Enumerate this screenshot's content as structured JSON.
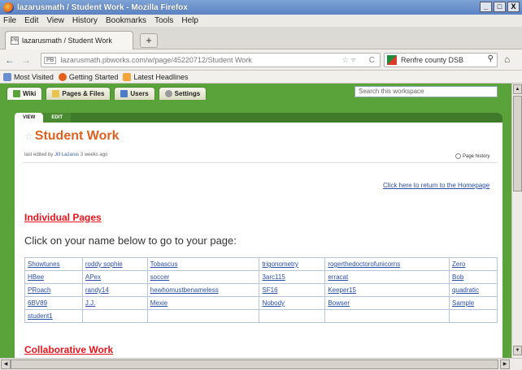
{
  "window": {
    "title": "lazarusmath / Student Work - Mozilla Firefox",
    "controls": [
      "_",
      "□",
      "X"
    ]
  },
  "menu": [
    "File",
    "Edit",
    "View",
    "History",
    "Bookmarks",
    "Tools",
    "Help"
  ],
  "tab": {
    "favicon": "PB",
    "label": "lazarusmath / Student Work",
    "new_tab": "+"
  },
  "nav": {
    "back": "←",
    "forward": "→",
    "url_badge": "PB",
    "url": "lazarusmath.pbworks.com/w/page/45220712/Student Work",
    "search_engine": "Renfre county DSB",
    "home": "⌂"
  },
  "bookmarks": [
    "Most Visited",
    "Getting Started",
    "Latest Headlines"
  ],
  "wiki": {
    "tabs": [
      {
        "label": "Wiki",
        "color": "#5aa33b"
      },
      {
        "label": "Pages & Files",
        "color": "#e8c24a"
      },
      {
        "label": "Users",
        "color": "#4a7cc8"
      },
      {
        "label": "Settings",
        "color": "#9a9a9a"
      }
    ],
    "search_placeholder": "Search this workspace",
    "view_label": "VIEW",
    "edit_label": "EDIT"
  },
  "page": {
    "title": "Student Work",
    "edited_prefix": "last edited by",
    "edited_user": "Jill Lazarus",
    "edited_when": "3 weeks ago",
    "history": "Page history",
    "home_link": "Click here to return to the Homepage",
    "section1": "Individual Pages",
    "intro": "Click on your name below to go to your page:",
    "names": [
      [
        "Showtunes",
        "roddy sophie",
        "Tobascus",
        "trigonometry",
        "rogerthedoctorofunicorns",
        "Zero"
      ],
      [
        "HBee",
        "APex",
        "soccer",
        "3arc115",
        "erracat",
        "Bob"
      ],
      [
        "PRoach",
        "randy14",
        "hewhomustbenameless",
        "SF16",
        "Keeper15",
        "quadratic"
      ],
      [
        "6BV89",
        "J.J.",
        "Mexie",
        "Nobody",
        "Bowser",
        "Sample"
      ],
      [
        "student1",
        "",
        "",
        "",
        "",
        ""
      ]
    ],
    "section2": "Collaborative Work"
  },
  "colors": {
    "wiki_green": "#5aa33b",
    "title_orange": "#e0601f",
    "heading_red": "#e8141b",
    "link_blue": "#2a4da8"
  }
}
